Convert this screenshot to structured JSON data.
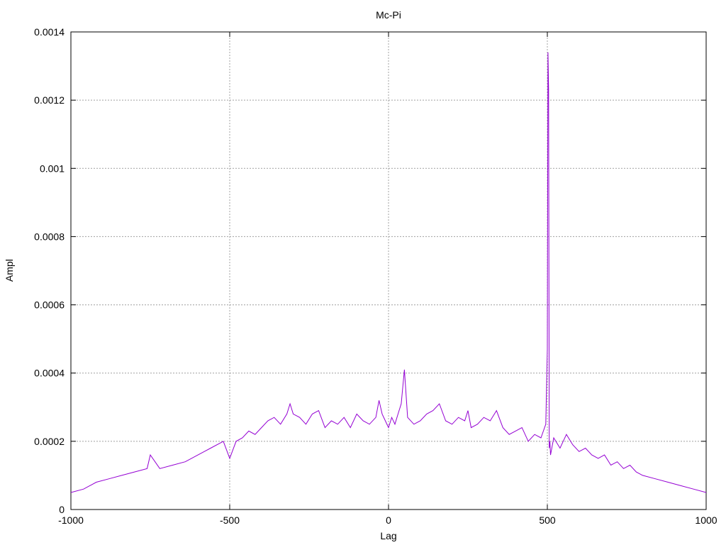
{
  "chart_data": {
    "type": "line",
    "title": "Mc-Pi",
    "xlabel": "Lag",
    "ylabel": "Ampl",
    "xlim": [
      -1000,
      1000
    ],
    "ylim": [
      0,
      0.0014
    ],
    "grid": true,
    "legend": "none",
    "x_ticks": [
      -1000,
      -500,
      0,
      500,
      1000
    ],
    "x_tick_labels": [
      "-1000",
      "-500",
      "0",
      "500",
      "1000"
    ],
    "y_ticks": [
      0,
      0.0002,
      0.0004,
      0.0006,
      0.0008,
      0.001,
      0.0012,
      0.0014
    ],
    "y_tick_labels": [
      "0",
      "0.0002",
      "0.0004",
      "0.0006",
      "0.0008",
      "0.001",
      "0.0012",
      "0.0014"
    ],
    "series": [
      {
        "color": "#9400d3",
        "x": [
          -1000,
          -960,
          -920,
          -880,
          -840,
          -800,
          -760,
          -750,
          -720,
          -680,
          -640,
          -600,
          -560,
          -520,
          -500,
          -480,
          -460,
          -440,
          -420,
          -400,
          -380,
          -360,
          -340,
          -320,
          -310,
          -300,
          -280,
          -260,
          -240,
          -220,
          -200,
          -180,
          -160,
          -140,
          -120,
          -100,
          -80,
          -60,
          -40,
          -30,
          -20,
          -10,
          0,
          10,
          20,
          30,
          40,
          50,
          60,
          80,
          100,
          120,
          140,
          160,
          180,
          200,
          220,
          240,
          250,
          260,
          280,
          300,
          320,
          340,
          360,
          380,
          400,
          420,
          440,
          460,
          480,
          495,
          500,
          502,
          504,
          506,
          508,
          510,
          520,
          540,
          560,
          580,
          600,
          620,
          640,
          660,
          680,
          700,
          720,
          740,
          760,
          780,
          800,
          840,
          880,
          920,
          960,
          1000
        ],
        "y": [
          5e-05,
          6e-05,
          8e-05,
          9e-05,
          0.0001,
          0.00011,
          0.00012,
          0.00016,
          0.00012,
          0.00013,
          0.00014,
          0.00016,
          0.00018,
          0.0002,
          0.00015,
          0.0002,
          0.00021,
          0.00023,
          0.00022,
          0.00024,
          0.00026,
          0.00027,
          0.00025,
          0.00028,
          0.00031,
          0.00028,
          0.00027,
          0.00025,
          0.00028,
          0.00029,
          0.00024,
          0.00026,
          0.00025,
          0.00027,
          0.00024,
          0.00028,
          0.00026,
          0.00025,
          0.00027,
          0.00032,
          0.00028,
          0.00026,
          0.00024,
          0.00027,
          0.00025,
          0.00028,
          0.00031,
          0.00041,
          0.00027,
          0.00025,
          0.00026,
          0.00028,
          0.00029,
          0.00031,
          0.00026,
          0.00025,
          0.00027,
          0.00026,
          0.00029,
          0.00024,
          0.00025,
          0.00027,
          0.00026,
          0.00029,
          0.00024,
          0.00022,
          0.00023,
          0.00024,
          0.0002,
          0.00022,
          0.00021,
          0.00025,
          0.00047,
          0.00134,
          0.00123,
          0.00018,
          0.0002,
          0.00016,
          0.00021,
          0.00018,
          0.00022,
          0.00019,
          0.00017,
          0.00018,
          0.00016,
          0.00015,
          0.00016,
          0.00013,
          0.00014,
          0.00012,
          0.00013,
          0.00011,
          0.0001,
          9e-05,
          8e-05,
          7e-05,
          6e-05,
          5e-05
        ]
      }
    ]
  }
}
